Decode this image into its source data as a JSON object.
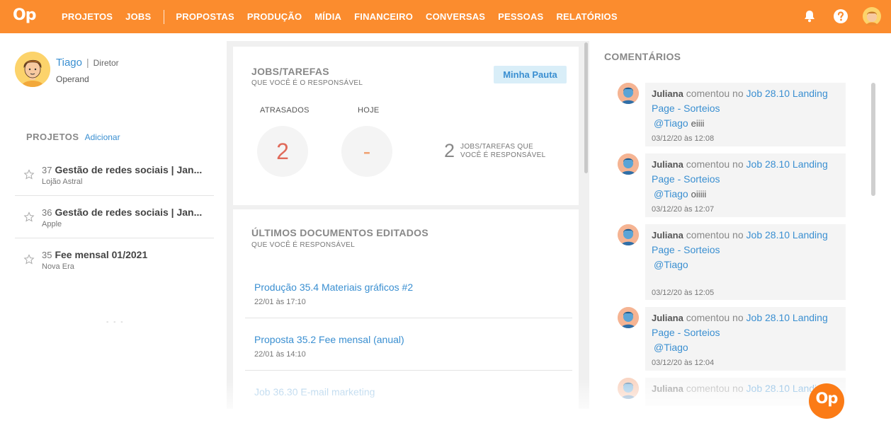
{
  "app": {
    "logo": "Op",
    "accent": "#fb8c2e",
    "link_color": "#3a8fd1"
  },
  "nav": {
    "group1": [
      "PROJETOS",
      "JOBS"
    ],
    "group2": [
      "PROPOSTAS",
      "PRODUÇÃO",
      "MÍDIA",
      "FINANCEIRO",
      "CONVERSAS",
      "PESSOAS",
      "RELATÓRIOS"
    ]
  },
  "top_icons": [
    "bell-icon",
    "help-icon",
    "avatar"
  ],
  "user": {
    "name": "Tiago",
    "role": "Diretor",
    "company": "Operand"
  },
  "projects": {
    "title": "PROJETOS",
    "add_label": "Adicionar",
    "items": [
      {
        "num": "37",
        "name": "Gestão de redes sociais | Jan...",
        "client": "Lojão Astral"
      },
      {
        "num": "36",
        "name": "Gestão de redes sociais | Jan...",
        "client": "Apple"
      },
      {
        "num": "35",
        "name": "Fee mensal 01/2021",
        "client": "Nova Era"
      }
    ],
    "more": "- - -"
  },
  "jobs": {
    "title": "JOBS/TAREFAS",
    "subtitle": "QUE VOCÊ É O RESPONSÁVEL",
    "button": "Minha Pauta",
    "late_label": "ATRASADOS",
    "late_value": "2",
    "today_label": "HOJE",
    "today_value": "-",
    "total_value": "2",
    "total_line1": "JOBS/TAREFAS QUE",
    "total_line2": "VOCÊ É RESPONSÁVEL"
  },
  "docs": {
    "title": "ÚLTIMOS DOCUMENTOS EDITADOS",
    "subtitle": "QUE VOCÊ É RESPONSÁVEL",
    "items": [
      {
        "name": "Produção 35.4 Materiais gráficos #2",
        "date": "22/01 às 17:10"
      },
      {
        "name": "Proposta 35.2 Fee mensal (anual)",
        "date": "22/01 às 14:10"
      },
      {
        "name": "Job 36.30 E-mail marketing",
        "date": ""
      }
    ]
  },
  "comments": {
    "title": "COMENTÁRIOS",
    "items": [
      {
        "user": "Juliana",
        "verb": "comentou no",
        "link": "Job 28.10 Landing Page - Sorteios",
        "mention": "@Tiago",
        "text": "eiiii",
        "date": "03/12/20 às 12:08"
      },
      {
        "user": "Juliana",
        "verb": "comentou no",
        "link": "Job 28.10 Landing Page - Sorteios",
        "mention": "@Tiago",
        "text": "oiiiii",
        "date": "03/12/20 às 12:07"
      },
      {
        "user": "Juliana",
        "verb": "comentou no",
        "link": "Job 28.10 Landing Page - Sorteios",
        "mention": "@Tiago",
        "text": "",
        "date": "03/12/20 às 12:05"
      },
      {
        "user": "Juliana",
        "verb": "comentou no",
        "link": "Job 28.10 Landing Page - Sorteios",
        "mention": "@Tiago",
        "text": "",
        "date": "03/12/20 às 12:04"
      },
      {
        "user": "Juliana",
        "verb": "comentou no",
        "link": "Job 28.10 Landin",
        "mention": "",
        "text": "",
        "date": ""
      }
    ]
  },
  "fab": {
    "label": "Op"
  }
}
